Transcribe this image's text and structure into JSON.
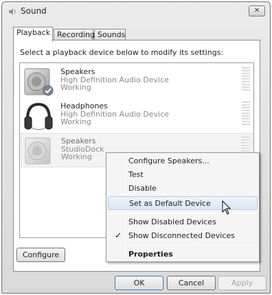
{
  "window": {
    "title": "Sound",
    "close_glyph": "✕"
  },
  "tabs": [
    {
      "label": "Playback",
      "active": true
    },
    {
      "label": "Recording",
      "active": false
    },
    {
      "label": "Sounds",
      "active": false
    }
  ],
  "instruction": "Select a playback device below to modify its settings:",
  "devices": [
    {
      "name": "Speakers",
      "description": "High Definition Audio Device",
      "status": "Working",
      "icon": "speaker-icon",
      "default": true
    },
    {
      "name": "Headphones",
      "description": "High Definition Audio Device",
      "status": "Working",
      "icon": "headphones-icon",
      "default": false
    },
    {
      "name": "Speakers",
      "description": "StudioDock",
      "status": "Working",
      "icon": "speaker-icon",
      "default": false,
      "disconnected": true
    }
  ],
  "context_menu": {
    "items": [
      {
        "label": "Configure Speakers..."
      },
      {
        "label": "Test"
      },
      {
        "label": "Disable"
      },
      {
        "label": "Set as Default Device",
        "hovered": true
      },
      {
        "label": "Show Disabled Devices"
      },
      {
        "label": "Show Disconnected Devices",
        "checked": true
      },
      {
        "label": "Properties",
        "bold": true
      }
    ],
    "check_glyph": "✓"
  },
  "buttons": {
    "configure": "Configure",
    "ok": "OK",
    "cancel": "Cancel",
    "apply": "Apply"
  },
  "colors": {
    "hover_border": "#b6cbe2",
    "default_badge": "#5a9a3c"
  }
}
